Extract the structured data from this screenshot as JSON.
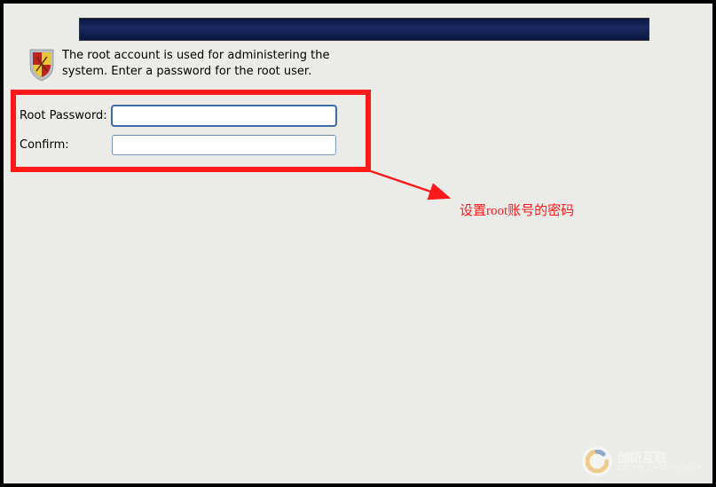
{
  "instructions": "The root account is used for administering the system.  Enter a password for the root user.",
  "form": {
    "password_label": "Root Password:",
    "password_value": "",
    "confirm_label": "Confirm:",
    "confirm_value": ""
  },
  "annotation": {
    "text": "设置root账号的密码"
  },
  "watermark": {
    "brand": "创新互联",
    "sub": "CDCXHL.CN/CDXWCX.CN"
  },
  "icons": {
    "shield": "shield-icon",
    "watermark_logo": "watermark-logo-icon"
  },
  "colors": {
    "highlight": "#fd1a1b",
    "banner_dark": "#0a1740"
  }
}
